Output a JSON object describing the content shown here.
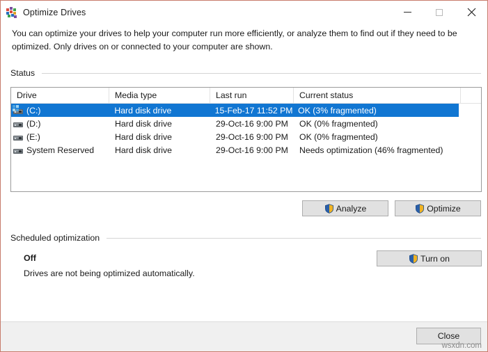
{
  "window": {
    "title": "Optimize Drives",
    "icon": "defrag-icon",
    "border_color": "#c77b6b",
    "controls": {
      "minimize": "Minimize",
      "maximize": "Maximize",
      "close": "Close"
    }
  },
  "description": "You can optimize your drives to help your computer run more efficiently, or analyze them to find out if they need to be optimized. Only drives on or connected to your computer are shown.",
  "status_group": {
    "label": "Status",
    "table": {
      "columns": [
        "Drive",
        "Media type",
        "Last run",
        "Current status"
      ],
      "rows": [
        {
          "drive": "(C:)",
          "media_type": "Hard disk drive",
          "last_run": "15-Feb-17 11:52 PM",
          "current_status": "OK (3% fragmented)",
          "icon": "system-drive-icon",
          "selected": true
        },
        {
          "drive": "(D:)",
          "media_type": "Hard disk drive",
          "last_run": "29-Oct-16 9:00 PM",
          "current_status": "OK (0% fragmented)",
          "icon": "drive-icon",
          "selected": false
        },
        {
          "drive": "(E:)",
          "media_type": "Hard disk drive",
          "last_run": "29-Oct-16 9:00 PM",
          "current_status": "OK (0% fragmented)",
          "icon": "drive-icon",
          "selected": false
        },
        {
          "drive": "System Reserved",
          "media_type": "Hard disk drive",
          "last_run": "29-Oct-16 9:00 PM",
          "current_status": "Needs optimization (46% fragmented)",
          "icon": "drive-icon",
          "selected": false
        }
      ]
    },
    "buttons": {
      "analyze": "Analyze",
      "optimize": "Optimize"
    }
  },
  "scheduled_group": {
    "label": "Scheduled optimization",
    "state": "Off",
    "note": "Drives are not being optimized automatically.",
    "turn_on_button": "Turn on"
  },
  "footer": {
    "close_button": "Close",
    "watermark": "wsxdn.com"
  },
  "colors": {
    "selection_blue": "#1176d2",
    "button_face": "#e1e1e1",
    "button_border": "#adadad",
    "footer_bg": "#f0f0f0",
    "shield_blue": "#2a5fa8",
    "shield_gold": "#f0b323"
  }
}
